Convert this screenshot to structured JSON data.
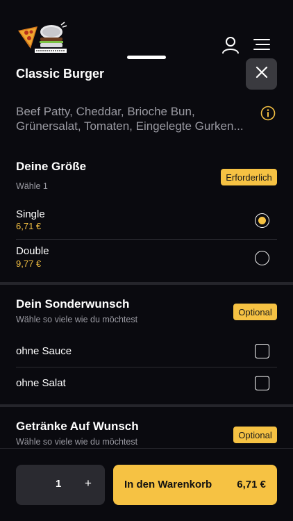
{
  "product": {
    "title": "Classic Burger",
    "description": "Beef Patty, Cheddar, Brioche Bun, Grünersalat, Tomaten, Eingelegte Gurken..."
  },
  "sections": [
    {
      "title": "Deine Größe",
      "subtitle": "Wähle 1",
      "badge": "Erforderlich",
      "options": [
        {
          "name": "Single",
          "price": "6,71 €",
          "selected": true
        },
        {
          "name": "Double",
          "price": "9,77 €",
          "selected": false
        }
      ]
    },
    {
      "title": "Dein Sonderwunsch",
      "subtitle": "Wähle so viele wie du möchtest",
      "badge": "Optional",
      "options": [
        {
          "name": "ohne Sauce",
          "checked": false
        },
        {
          "name": "ohne Salat",
          "checked": false
        }
      ]
    },
    {
      "title": "Getränke Auf Wunsch",
      "subtitle": "Wähle so viele wie du möchtest",
      "badge": "Optional"
    }
  ],
  "footer": {
    "quantity": "1",
    "plus": "+",
    "cart_label": "In den Warenkorb",
    "cart_price": "6,71 €"
  },
  "colors": {
    "background": "#0a0a0f",
    "accent": "#f6c243",
    "muted_text": "#9a9aa2"
  },
  "icons": {
    "user": "user-icon",
    "menu": "menu-icon",
    "close": "close-icon",
    "info": "info-icon"
  }
}
